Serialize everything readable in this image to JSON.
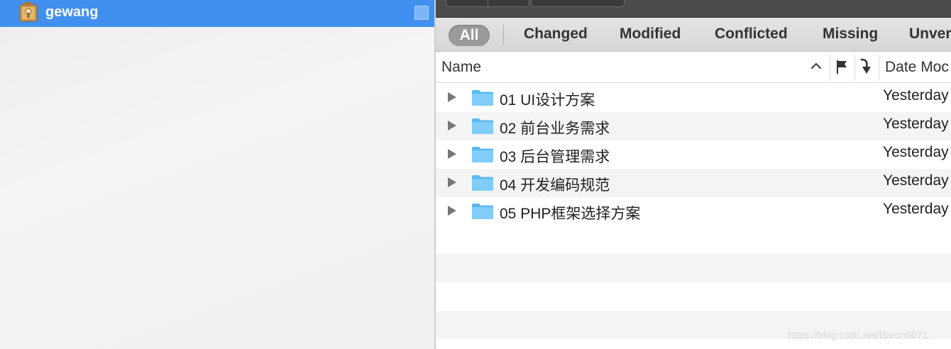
{
  "sidebar": {
    "repository": {
      "name": "gewang",
      "icon": "repository-icon"
    }
  },
  "filters": {
    "items": [
      "All",
      "Changed",
      "Modified",
      "Conflicted",
      "Missing",
      "Unver"
    ],
    "selected": "All"
  },
  "columns": {
    "name": "Name",
    "date": "Date Moc"
  },
  "rows": [
    {
      "name": "01 UI设计方案",
      "date": "Yesterday"
    },
    {
      "name": "02 前台业务需求",
      "date": "Yesterday"
    },
    {
      "name": "03 后台管理需求",
      "date": "Yesterday"
    },
    {
      "name": "04 开发编码规范",
      "date": "Yesterday"
    },
    {
      "name": "05 PHP框架选择方案",
      "date": "Yesterday"
    }
  ],
  "watermark": "https://blog.csdn.net/Baron0071",
  "colors": {
    "selection": "#4190f0",
    "folder": "#6cc3f5"
  }
}
